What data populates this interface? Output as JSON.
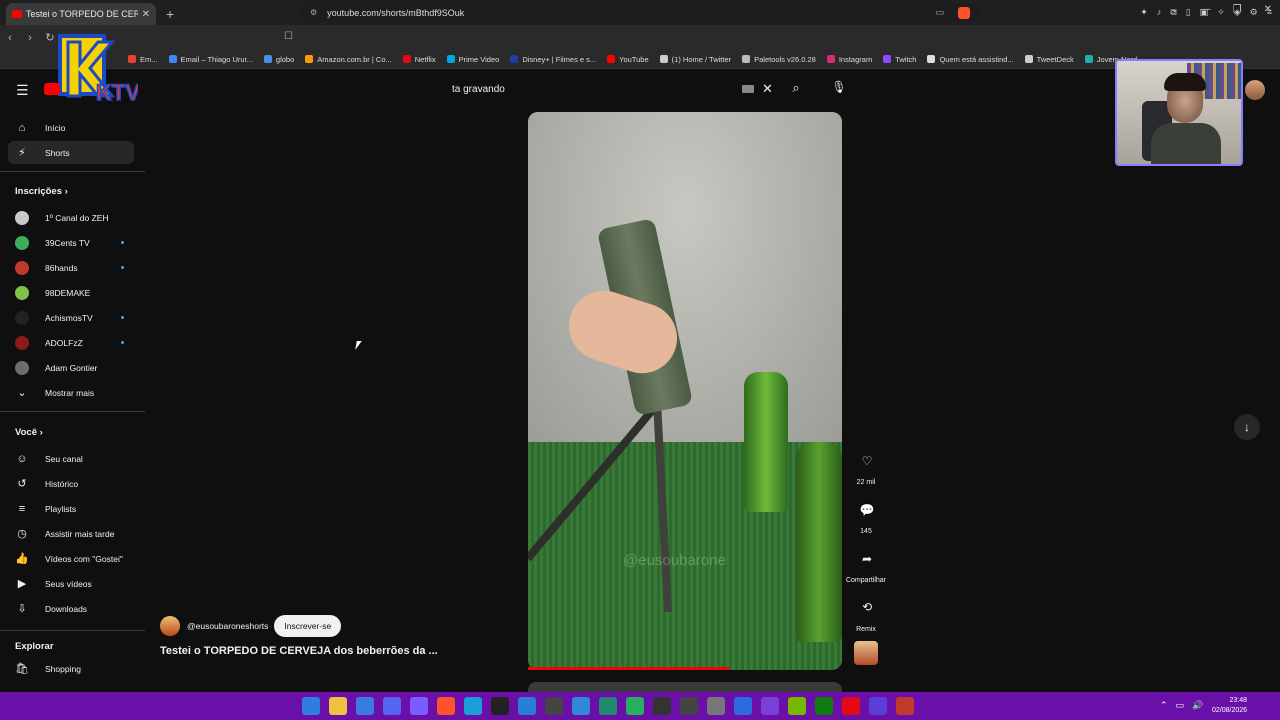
{
  "browser": {
    "tab_title": "Testei o TORPEDO DE CERVEJA dos beberrões da ...",
    "url": "youtube.com/shorts/mBthdf9SOuk",
    "bookmarks": [
      {
        "label": "Em...",
        "color": "#ea4335"
      },
      {
        "label": "Email – Thiago Urur...",
        "color": "#4285f4"
      },
      {
        "label": "globo",
        "color": "#4a90e2"
      },
      {
        "label": "Amazon.com.br | Co...",
        "color": "#ff9900"
      },
      {
        "label": "Netflix",
        "color": "#e50914"
      },
      {
        "label": "Prime Video",
        "color": "#00a8e1"
      },
      {
        "label": "Disney+ | Filmes e s...",
        "color": "#1b3fa0"
      },
      {
        "label": "YouTube",
        "color": "#ff0000"
      },
      {
        "label": "(1) Home / Twitter",
        "color": "#cccccc"
      },
      {
        "label": "Paletools v26.0.28",
        "color": "#bbbbbb"
      },
      {
        "label": "Instagram",
        "color": "#d62976"
      },
      {
        "label": "Twitch",
        "color": "#9146ff"
      },
      {
        "label": "Quem está assistind...",
        "color": "#dddddd"
      },
      {
        "label": "TweetDeck",
        "color": "#cccccc"
      },
      {
        "label": "Jovem Nerd -",
        "color": "#20b2aa"
      }
    ]
  },
  "overlay": {
    "logo_text": "KTV"
  },
  "youtube": {
    "search_value": "ta gravando",
    "sidebar": {
      "main": [
        {
          "label": "Início",
          "icon": "home-icon",
          "glyph": "⌂"
        },
        {
          "label": "Shorts",
          "icon": "shorts-icon",
          "glyph": "⚡"
        }
      ],
      "subs_header": "Inscrições",
      "subs": [
        {
          "label": "1º Canal do ZEH",
          "color": "#c9c9c9",
          "new": false
        },
        {
          "label": "39Cents TV",
          "color": "#3cae5a",
          "new": true
        },
        {
          "label": "86hands",
          "color": "#c0392b",
          "new": true
        },
        {
          "label": "98DEMAKE",
          "color": "#7fc24a",
          "new": false
        },
        {
          "label": "AchismosTV",
          "color": "#222222",
          "new": true
        },
        {
          "label": "ADOLFzZ",
          "color": "#8b1a1a",
          "new": true
        },
        {
          "label": "Adam Gontier",
          "color": "#6d6d6d",
          "new": false
        }
      ],
      "show_more": "Mostrar mais",
      "you_header": "Você",
      "you": [
        {
          "label": "Seu canal",
          "icon": "channel-icon",
          "glyph": "☺"
        },
        {
          "label": "Histórico",
          "icon": "history-icon",
          "glyph": "↺"
        },
        {
          "label": "Playlists",
          "icon": "playlist-icon",
          "glyph": "≡"
        },
        {
          "label": "Assistir mais tarde",
          "icon": "clock-icon",
          "glyph": "◷"
        },
        {
          "label": "Vídeos com \"Gostei\"",
          "icon": "like-icon",
          "glyph": "👍"
        },
        {
          "label": "Seus vídeos",
          "icon": "video-icon",
          "glyph": "▶"
        },
        {
          "label": "Downloads",
          "icon": "download-icon",
          "glyph": "⇩"
        }
      ],
      "explore_header": "Explorar",
      "explore": [
        {
          "label": "Shopping",
          "icon": "shopping-icon",
          "glyph": "🛍"
        }
      ]
    },
    "short": {
      "watermark": "@eusoubarone",
      "likes": "22 mil",
      "comments": "145",
      "share_label": "Compartilhar",
      "remix_label": "Remix",
      "channel_handle": "@eusoubaroneshorts",
      "subscribe_label": "Inscrever-se",
      "title": "Testei o TORPEDO DE CERVEJA dos beberrões da ...",
      "progress_fraction": 0.64
    }
  },
  "taskbar": {
    "time": "23:48",
    "date": "02/08/2026",
    "accent": "#6a0fa8",
    "apps": [
      "#2f7de1",
      "#f0c040",
      "#3a7be0",
      "#5865f2",
      "#7b5cff",
      "#fb542b",
      "#1b9ed8",
      "#222222",
      "#2a7fd4",
      "#444444",
      "#2f88d8",
      "#1f8a70",
      "#27ae60",
      "#333333",
      "#444444",
      "#777777",
      "#2d6cdf",
      "#7a3fd6",
      "#76b900",
      "#107c10",
      "#e50914",
      "#5a3fd6",
      "#c0392b"
    ]
  }
}
